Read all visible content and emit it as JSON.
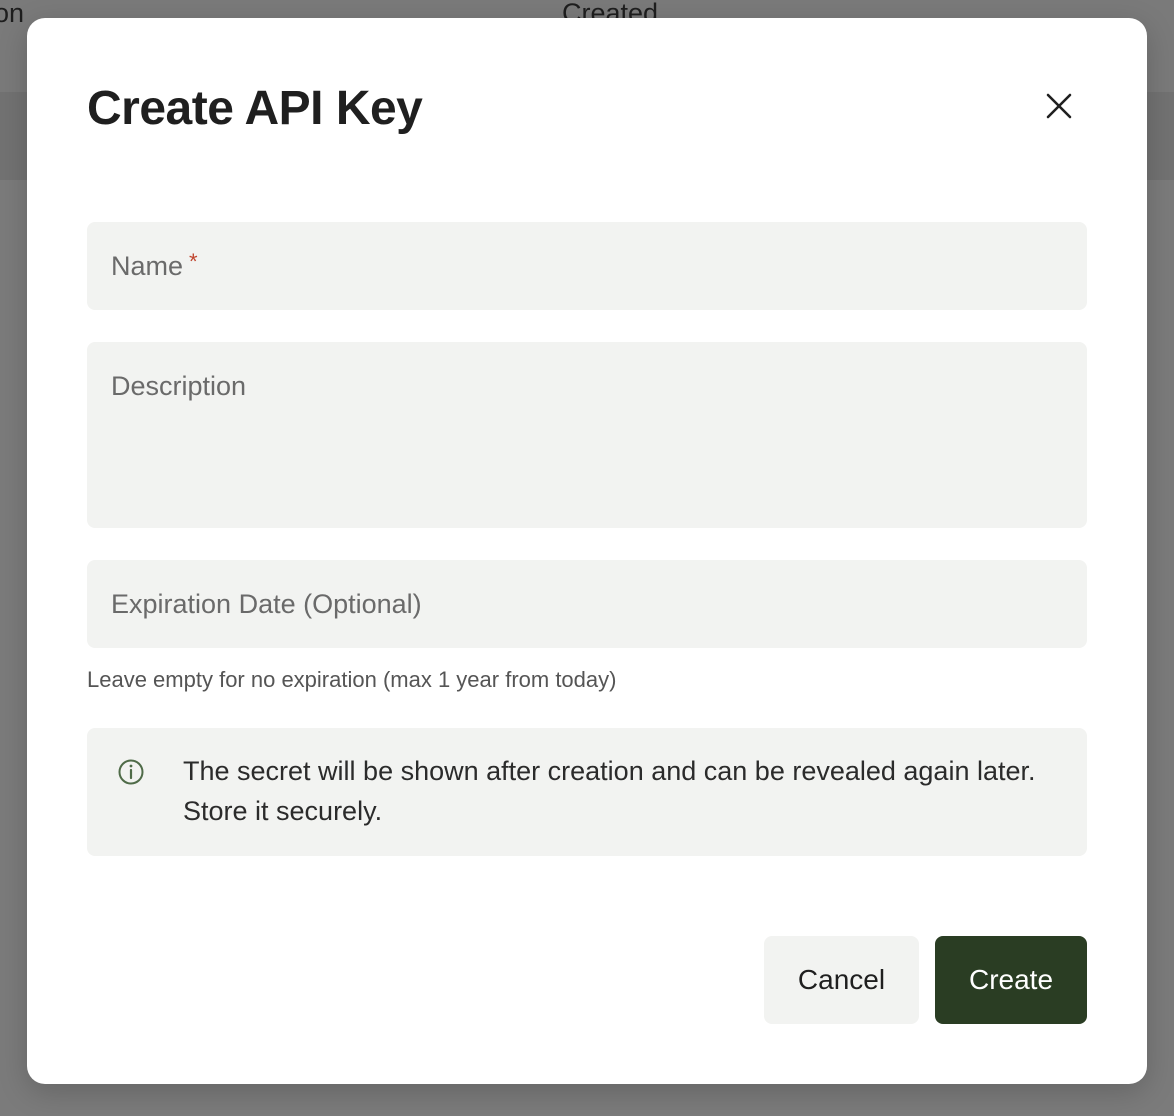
{
  "background": {
    "column_left_label": "on",
    "column_mid_label": "Created"
  },
  "modal": {
    "title": "Create API Key",
    "close_icon": "close-icon",
    "fields": {
      "name": {
        "placeholder": "Name",
        "required_marker": "*",
        "value": ""
      },
      "description": {
        "placeholder": "Description",
        "value": ""
      },
      "expiration": {
        "placeholder": "Expiration Date (Optional)",
        "value": ""
      }
    },
    "expiration_hint": "Leave empty for no expiration (max 1 year from today)",
    "info": {
      "icon": "info-icon",
      "text": "The secret will be shown after creation and can be revealed again later. Store it securely."
    },
    "actions": {
      "cancel_label": "Cancel",
      "create_label": "Create"
    }
  },
  "colors": {
    "primary_button": "#2a3d23",
    "field_background": "#f2f3f1",
    "required_marker": "#c0452f"
  }
}
